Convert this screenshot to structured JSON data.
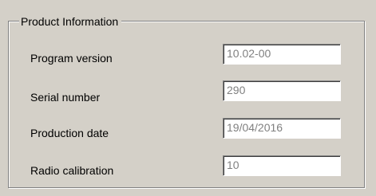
{
  "group": {
    "title": "Product Information"
  },
  "fields": [
    {
      "label": "Program version",
      "value": "10.02-00"
    },
    {
      "label": "Serial number",
      "value": "290"
    },
    {
      "label": "Production date",
      "value": "19/04/2016"
    },
    {
      "label": "Radio calibration",
      "value": "10"
    }
  ]
}
